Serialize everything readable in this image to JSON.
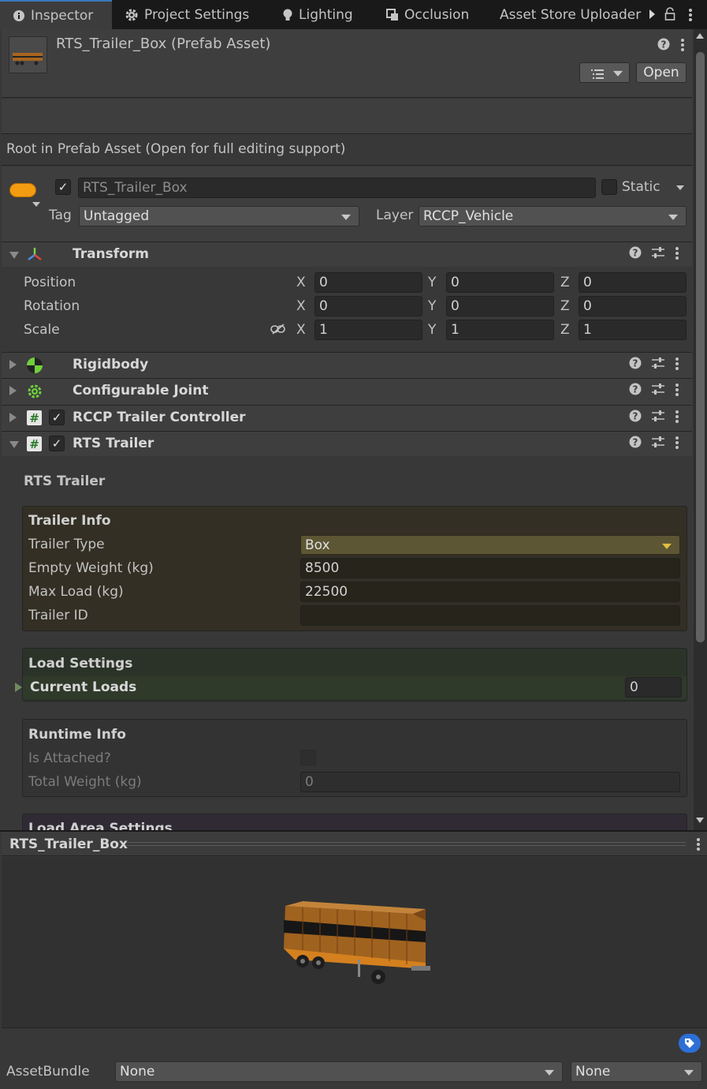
{
  "tabs": [
    {
      "label": "Inspector",
      "icon": "info-icon"
    },
    {
      "label": "Project Settings",
      "icon": "gear-icon"
    },
    {
      "label": "Lighting",
      "icon": "light-bulb-icon"
    },
    {
      "label": "Occlusion",
      "icon": "occlusion-icon"
    },
    {
      "label": "Asset Store Uploader",
      "icon": ""
    }
  ],
  "header": {
    "title": "RTS_Trailer_Box (Prefab Asset)",
    "open_label": "Open"
  },
  "root_notice": "Root in Prefab Asset (Open for full editing support)",
  "gameobject": {
    "name": "RTS_Trailer_Box",
    "static_label": "Static",
    "tag_label": "Tag",
    "tag_value": "Untagged",
    "layer_label": "Layer",
    "layer_value": "RCCP_Vehicle"
  },
  "transform": {
    "title": "Transform",
    "rows": [
      {
        "label": "Position",
        "x": "0",
        "y": "0",
        "z": "0"
      },
      {
        "label": "Rotation",
        "x": "0",
        "y": "0",
        "z": "0"
      },
      {
        "label": "Scale",
        "x": "1",
        "y": "1",
        "z": "1"
      }
    ],
    "axes": {
      "x": "X",
      "y": "Y",
      "z": "Z"
    }
  },
  "components": {
    "rigidbody": "Rigidbody",
    "joint": "Configurable Joint",
    "rccp": "RCCP Trailer Controller",
    "rts": "RTS Trailer"
  },
  "rts_trailer": {
    "heading": "RTS Trailer",
    "info": {
      "title": "Trailer Info",
      "type_label": "Trailer Type",
      "type_value": "Box",
      "empty_label": "Empty Weight (kg)",
      "empty_value": "8500",
      "max_label": "Max Load (kg)",
      "max_value": "22500",
      "id_label": "Trailer ID",
      "id_value": ""
    },
    "load": {
      "title": "Load Settings",
      "current_label": "Current Loads",
      "current_value": "0"
    },
    "runtime": {
      "title": "Runtime Info",
      "attached_label": "Is Attached?",
      "total_label": "Total Weight (kg)",
      "total_value": "0"
    },
    "load_area": {
      "title": "Load Area Settings"
    }
  },
  "preview": {
    "title": "RTS_Trailer_Box"
  },
  "assetbundle": {
    "label": "AssetBundle",
    "name": "None",
    "variant": "None"
  }
}
